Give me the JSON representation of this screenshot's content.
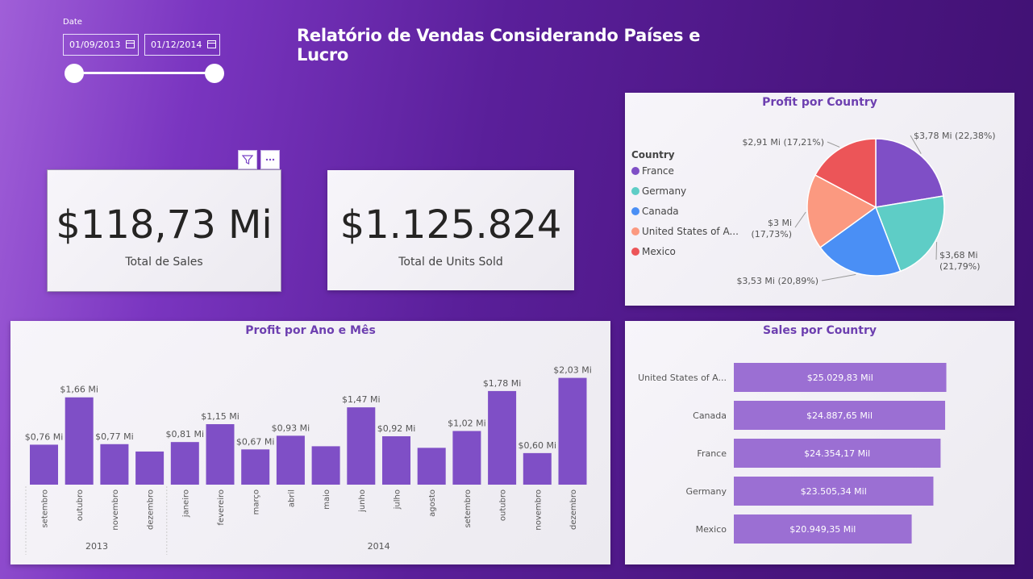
{
  "page": {
    "title": "Relatório de Vendas Considerando Países e Lucro"
  },
  "slicer": {
    "label": "Date",
    "start_date": "01/09/2013",
    "end_date": "01/12/2014"
  },
  "kpis": [
    {
      "value": "$118,73 Mi",
      "label": "Total de Sales"
    },
    {
      "value": "$1.125.824",
      "label": "Total de Units Sold"
    }
  ],
  "colors": {
    "bar": "#7f4fc6",
    "hbar": "#9b6fd3",
    "title": "#6d3fb0",
    "france": "#7f4fc6",
    "germany": "#5ecdc6",
    "canada": "#4a8ff5",
    "usa": "#fb9980",
    "mexico": "#ec5558"
  },
  "chart_data": [
    {
      "type": "pie",
      "title": "Profit por Country",
      "legend_title": "Country",
      "legend_placement": "left",
      "slices": [
        {
          "name": "France",
          "legend_label": "France",
          "value": 3.78,
          "percent": 22.38,
          "label": "$3,78 Mi (22,38%)",
          "color": "#7f4fc6"
        },
        {
          "name": "Germany",
          "legend_label": "Germany",
          "value": 3.68,
          "percent": 21.79,
          "label_line1": "$3,68 Mi",
          "label_line2": "(21,79%)",
          "color": "#5ecdc6"
        },
        {
          "name": "Canada",
          "legend_label": "Canada",
          "value": 3.53,
          "percent": 20.89,
          "label": "$3,53 Mi (20,89%)",
          "color": "#4a8ff5"
        },
        {
          "name": "United States of America",
          "legend_label": "United States of A...",
          "value": 3.0,
          "percent": 17.73,
          "label_line1": "$3 Mi",
          "label_line2": "(17,73%)",
          "color": "#fb9980"
        },
        {
          "name": "Mexico",
          "legend_label": "Mexico",
          "value": 2.91,
          "percent": 17.21,
          "label": "$2,91 Mi (17,21%)",
          "color": "#ec5558"
        }
      ]
    },
    {
      "type": "bar",
      "title": "Profit por Ano e Mês",
      "unit": "Mi",
      "ylim": [
        0,
        2.3
      ],
      "groups": [
        {
          "year": "2013",
          "months": [
            "setembro",
            "outubro",
            "novembro",
            "dezembro"
          ]
        },
        {
          "year": "2014",
          "months": [
            "janeiro",
            "fevereiro",
            "março",
            "abril",
            "maio",
            "junho",
            "julho",
            "agosto",
            "setembro",
            "outubro",
            "novembro",
            "dezembro"
          ]
        }
      ],
      "values": [
        0.76,
        1.66,
        0.77,
        0.63,
        0.81,
        1.15,
        0.67,
        0.93,
        0.73,
        1.47,
        0.92,
        0.7,
        1.02,
        1.78,
        0.6,
        2.03
      ],
      "data_labels": [
        "$0,76 Mi",
        "$1,66 Mi",
        "$0,77 Mi",
        "",
        "$0,81 Mi",
        "$1,15 Mi",
        "$0,67 Mi",
        "$0,93 Mi",
        "",
        "$1,47 Mi",
        "$0,92 Mi",
        "",
        "$1,02 Mi",
        "$1,78 Mi",
        "$0,60 Mi",
        "$2,03 Mi"
      ]
    },
    {
      "type": "bar",
      "orientation": "horizontal",
      "title": "Sales por Country",
      "unit": "Mil",
      "xlim": [
        0,
        26500
      ],
      "categories": [
        "United States of A...",
        "Canada",
        "France",
        "Germany",
        "Mexico"
      ],
      "values": [
        25029.83,
        24887.65,
        24354.17,
        23505.34,
        20949.35
      ],
      "data_labels": [
        "$25.029,83 Mil",
        "$24.887,65 Mil",
        "$24.354,17 Mil",
        "$23.505,34 Mil",
        "$20.949,35 Mil"
      ]
    }
  ]
}
